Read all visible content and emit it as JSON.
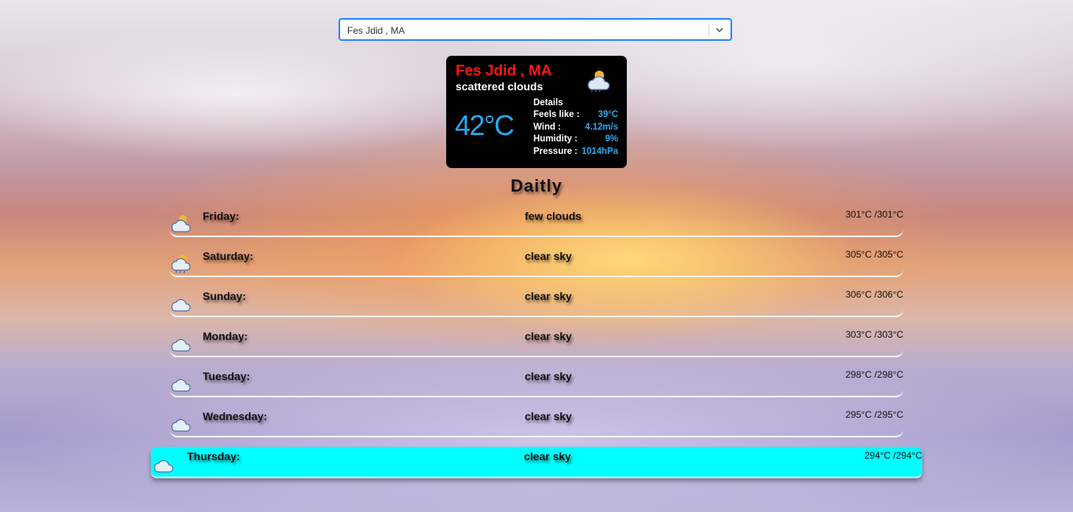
{
  "search": {
    "value": "Fes Jdid , MA"
  },
  "current": {
    "city": "Fes Jdid , MA",
    "description": "scattered clouds",
    "icon": "scattered-clouds-sun-icon",
    "temperature": "42°C",
    "details_title": "Details",
    "details": [
      {
        "label": "Feels like :",
        "value": "39°C"
      },
      {
        "label": "Wind :",
        "value": "4.12m/s"
      },
      {
        "label": "Humidity :",
        "value": "9%"
      },
      {
        "label": "Pressure :",
        "value": "1014hPa"
      }
    ]
  },
  "section_title": "Daitly",
  "days": [
    {
      "name": "Friday:",
      "description": "few clouds",
      "temp": "301°C /301°C",
      "icon": "sun-cloud-icon"
    },
    {
      "name": "Saturday:",
      "description": "clear sky",
      "temp": "305°C /305°C",
      "icon": "sun-cloud-rain-icon"
    },
    {
      "name": "Sunday:",
      "description": "clear sky",
      "temp": "306°C /306°C",
      "icon": "cloud-icon"
    },
    {
      "name": "Monday:",
      "description": "clear sky",
      "temp": "303°C /303°C",
      "icon": "cloud-icon"
    },
    {
      "name": "Tuesday:",
      "description": "clear sky",
      "temp": "298°C /298°C",
      "icon": "cloud-icon"
    },
    {
      "name": "Wednesday:",
      "description": "clear sky",
      "temp": "295°C /295°C",
      "icon": "cloud-icon"
    },
    {
      "name": "Thursday:",
      "description": "clear sky",
      "temp": "294°C /294°C",
      "icon": "cloud-icon",
      "selected": true
    }
  ],
  "colors": {
    "accent_blue": "#29a8f0",
    "city_red": "#ff1515",
    "selected_row": "#00ffff",
    "card_bg": "#000000"
  }
}
